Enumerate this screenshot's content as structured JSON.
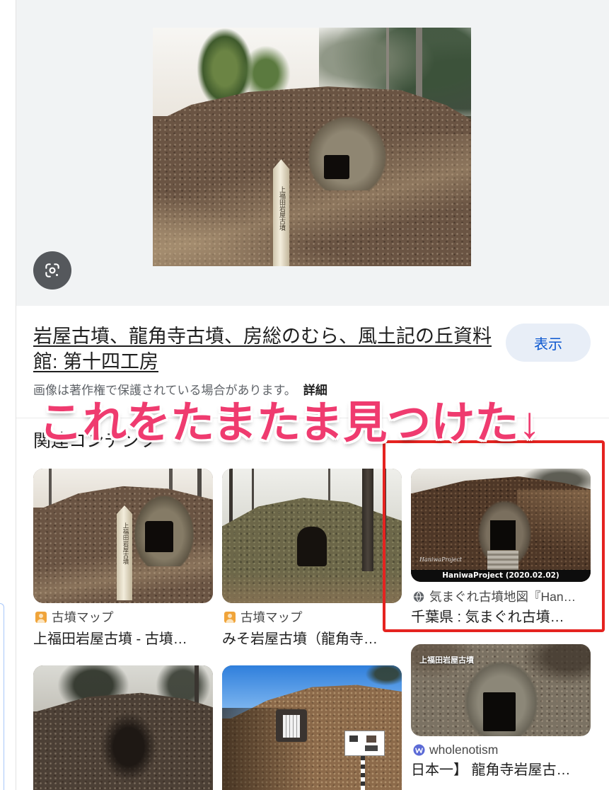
{
  "viewer": {
    "lens_icon": "lens-icon",
    "post_text": "上福田岩屋古墳"
  },
  "result": {
    "title": "岩屋古墳、龍角寺古墳、房総のむら、風土記の丘資料館: 第十四工房",
    "view_button": "表示",
    "copyright_note": "画像は著作権で保護されている場合があります。",
    "details_link": "詳細"
  },
  "related": {
    "heading": "関連コンテンツ",
    "items": [
      {
        "source": "古墳マップ",
        "source_icon": "person-icon",
        "title": "上福田岩屋古墳 - 古墳…",
        "image_text": "上福田岩屋古墳"
      },
      {
        "source": "古墳マップ",
        "source_icon": "person-icon",
        "title": "みそ岩屋古墳（龍角寺…"
      },
      {
        "source": "気まぐれ古墳地図『Han…",
        "source_icon": "globe-icon",
        "title": "千葉県 : 気まぐれ古墳…",
        "image_watermark": "HaniwaProject",
        "image_caption": "HaniwaProject (2020.02.02)"
      },
      {
        "source": "wholenotism",
        "source_icon": "wordpress-icon",
        "title": "日本一】 龍角寺岩屋古…",
        "image_text": "上福田岩屋古墳"
      }
    ]
  },
  "annotation": {
    "text": "これをたまたま見つけた↓",
    "text_color": "#ef3b6f",
    "box_color": "#e52320"
  },
  "colors": {
    "viewer_bg": "#f1f3f4",
    "button_bg": "#e8eef7",
    "link_blue": "#0b57d0"
  }
}
